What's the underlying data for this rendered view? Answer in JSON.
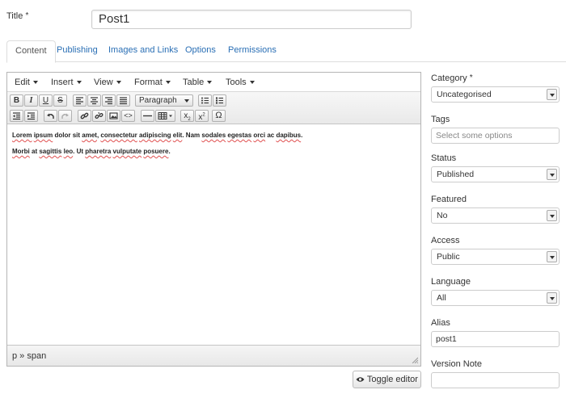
{
  "title_field": {
    "label": "Title",
    "required_mark": "*",
    "value": "Post1"
  },
  "tabs": [
    {
      "label": "Content",
      "active": true
    },
    {
      "label": "Publishing"
    },
    {
      "label": "Images and Links"
    },
    {
      "label": "Options"
    },
    {
      "label": "Permissions"
    }
  ],
  "editor": {
    "menus": [
      "Edit",
      "Insert",
      "View",
      "Format",
      "Table",
      "Tools"
    ],
    "format_select": "Paragraph",
    "paragraphs": [
      "Lorem ipsum dolor sit amet, consectetur adipiscing elit. Nam sodales egestas orci ac dapibus.",
      "Morbi at sagittis leo. Ut pharetra vulputate posuere."
    ],
    "path": "p » span",
    "toggle_label": "Toggle editor"
  },
  "sidebar": {
    "category": {
      "label": "Category",
      "required_mark": "*",
      "value": "Uncategorised"
    },
    "tags": {
      "label": "Tags",
      "placeholder": "Select some options"
    },
    "status": {
      "label": "Status",
      "value": "Published"
    },
    "featured": {
      "label": "Featured",
      "value": "No"
    },
    "access": {
      "label": "Access",
      "value": "Public"
    },
    "language": {
      "label": "Language",
      "value": "All"
    },
    "alias": {
      "label": "Alias",
      "value": "post1"
    },
    "version_note": {
      "label": "Version Note",
      "value": ""
    }
  },
  "colors": {
    "link": "#2a6fb5",
    "border": "#cccccc"
  }
}
